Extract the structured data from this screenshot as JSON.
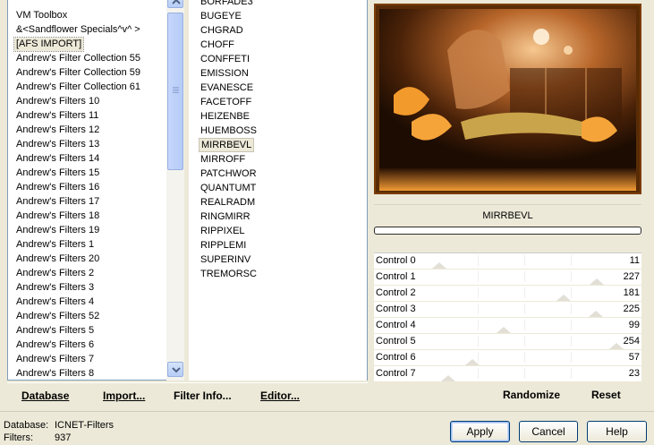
{
  "categories": {
    "items": [
      "VM Toolbox",
      "&<Sandflower Specials^v^ >",
      "[AFS IMPORT]",
      "Andrew's Filter Collection 55",
      "Andrew's Filter Collection 59",
      "Andrew's Filter Collection 61",
      "Andrew's Filters 10",
      "Andrew's Filters 11",
      "Andrew's Filters 12",
      "Andrew's Filters 13",
      "Andrew's Filters 14",
      "Andrew's Filters 15",
      "Andrew's Filters 16",
      "Andrew's Filters 17",
      "Andrew's Filters 18",
      "Andrew's Filters 19",
      "Andrew's Filters 1",
      "Andrew's Filters 20",
      "Andrew's Filters 2",
      "Andrew's Filters 3",
      "Andrew's Filters 4",
      "Andrew's Filters 52",
      "Andrew's Filters 5",
      "Andrew's Filters 6",
      "Andrew's Filters 7",
      "Andrew's Filters 8"
    ],
    "selected": "[AFS IMPORT]"
  },
  "left_buttons": {
    "database": "Database",
    "import": "Import...",
    "filter_info": "Filter Info...",
    "editor": "Editor..."
  },
  "filters": {
    "items": [
      "BORFADE3",
      "BUGEYE",
      "CHGRAD",
      "CHOFF",
      "CONFFETI",
      "EMISSION",
      "EVANESCE",
      "FACETOFF",
      "HEIZENBE",
      "HUEMBOSS",
      "MIRRBEVL",
      "MIRROFF",
      "PATCHWOR",
      "QUANTUMT",
      "REALRADM",
      "RINGMIRR",
      "RIPPIXEL",
      "RIPPLEMI",
      "SUPERINV",
      "TREMORSC"
    ],
    "selected": "MIRRBEVL"
  },
  "preview": {
    "filter_name": "MIRRBEVL",
    "progress": 0
  },
  "controls": [
    {
      "label": "Control 0",
      "value": "11",
      "level": 11
    },
    {
      "label": "Control 1",
      "value": "227",
      "level": 227
    },
    {
      "label": "Control 2",
      "value": "181",
      "level": 181
    },
    {
      "label": "Control 3",
      "value": "225",
      "level": 225
    },
    {
      "label": "Control 4",
      "value": "99",
      "level": 99
    },
    {
      "label": "Control 5",
      "value": "254",
      "level": 254
    },
    {
      "label": "Control 6",
      "value": "57",
      "level": 57
    },
    {
      "label": "Control 7",
      "value": "23",
      "level": 23
    }
  ],
  "control_max": 255,
  "right_buttons": {
    "randomize": "Randomize",
    "reset": "Reset"
  },
  "info": {
    "database_label": "Database:",
    "database_value": "ICNET-Filters",
    "filters_label": "Filters:",
    "filters_value": "937"
  },
  "dialog_buttons": {
    "apply": "Apply",
    "cancel": "Cancel",
    "help": "Help"
  },
  "colors": {
    "selection": "#ece9d8",
    "preview_frame": "#7a3d0a",
    "accent_blue": "#003c74"
  },
  "icons": {
    "scroll_up": "chevron-up-icon",
    "scroll_down": "chevron-down-icon",
    "scroll_grip": "grip-icon"
  }
}
